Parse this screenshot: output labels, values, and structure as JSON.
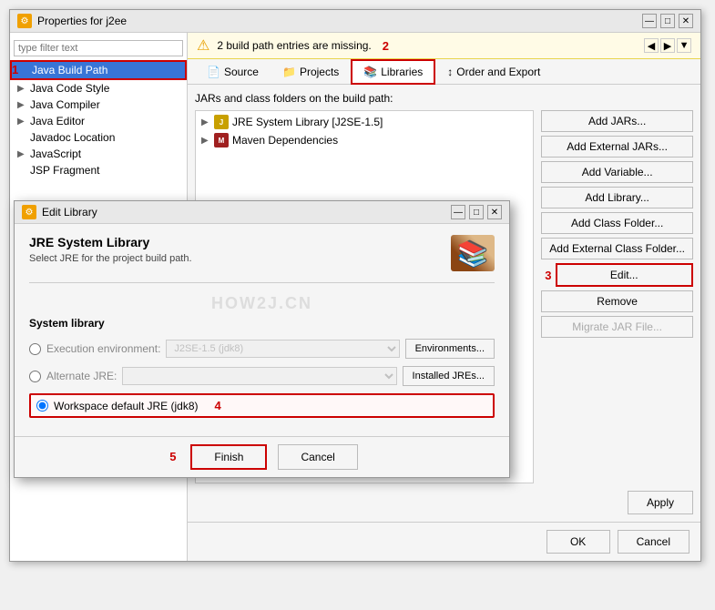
{
  "mainWindow": {
    "title": "Properties for j2ee",
    "titleIcon": "⚙",
    "filterPlaceholder": "type filter text"
  },
  "sidebar": {
    "items": [
      {
        "id": "java-build-path",
        "label": "Java Build Path",
        "selected": true,
        "hasArrow": false
      },
      {
        "id": "java-code-style",
        "label": "Java Code Style",
        "hasArrow": true
      },
      {
        "id": "java-compiler",
        "label": "Java Compiler",
        "hasArrow": true
      },
      {
        "id": "java-editor",
        "label": "Java Editor",
        "hasArrow": true
      },
      {
        "id": "javadoc-location",
        "label": "Javadoc Location",
        "hasArrow": false
      },
      {
        "id": "javascript",
        "label": "JavaScript",
        "hasArrow": true
      },
      {
        "id": "jsp-fragment",
        "label": "JSP Fragment",
        "hasArrow": false
      }
    ]
  },
  "warningBar": {
    "icon": "⚠",
    "message": "2 build path entries are missing.",
    "stepBadge": "2"
  },
  "tabs": [
    {
      "id": "source",
      "label": "Source",
      "icon": "📄"
    },
    {
      "id": "projects",
      "label": "Projects",
      "icon": "📁"
    },
    {
      "id": "libraries",
      "label": "Libraries",
      "icon": "📚",
      "active": true
    },
    {
      "id": "order-export",
      "label": "Order and Export",
      "icon": "↕"
    }
  ],
  "libraries": {
    "description": "JARs and class folders on the build path:",
    "items": [
      {
        "id": "jre-system-lib",
        "label": "JRE System Library [J2SE-1.5]",
        "type": "jre",
        "expanded": false
      },
      {
        "id": "maven-deps",
        "label": "Maven Dependencies",
        "type": "maven",
        "expanded": false
      }
    ],
    "buttons": [
      {
        "id": "add-jars",
        "label": "Add JARs..."
      },
      {
        "id": "add-external-jars",
        "label": "Add External JARs..."
      },
      {
        "id": "add-variable",
        "label": "Add Variable..."
      },
      {
        "id": "add-library",
        "label": "Add Library..."
      },
      {
        "id": "add-class-folder",
        "label": "Add Class Folder..."
      },
      {
        "id": "add-external-class-folder",
        "label": "Add External Class Folder..."
      },
      {
        "id": "edit",
        "label": "Edit...",
        "highlighted": true
      },
      {
        "id": "remove",
        "label": "Remove"
      },
      {
        "id": "migrate-jar",
        "label": "Migrate JAR File...",
        "disabled": true
      }
    ]
  },
  "mainBottomButtons": [
    {
      "id": "apply",
      "label": "Apply"
    },
    {
      "id": "ok",
      "label": "OK"
    },
    {
      "id": "cancel",
      "label": "Cancel"
    }
  ],
  "stepBadge1": "1",
  "stepBadge3": "3",
  "editDialog": {
    "title": "Edit Library",
    "titleIcon": "⚙",
    "header": {
      "title": "JRE System Library",
      "subtitle": "Select JRE for the project build path."
    },
    "watermark": "HOW2J.CN",
    "systemLibLabel": "System library",
    "radioOptions": [
      {
        "id": "execution-env",
        "label": "Execution environment:",
        "value": "J2SE-1.5 (jdk8)",
        "button": "Environments...",
        "checked": false,
        "disabled": true
      },
      {
        "id": "alternate-jre",
        "label": "Alternate JRE:",
        "value": "",
        "button": "Installed JREs...",
        "checked": false,
        "disabled": true
      },
      {
        "id": "workspace-default",
        "label": "Workspace default JRE (jdk8)",
        "checked": true,
        "highlighted": true
      }
    ],
    "stepBadge4": "4",
    "bottomButtons": [
      {
        "id": "finish",
        "label": "Finish",
        "primary": true
      },
      {
        "id": "cancel",
        "label": "Cancel"
      }
    ],
    "stepBadge5": "5"
  }
}
